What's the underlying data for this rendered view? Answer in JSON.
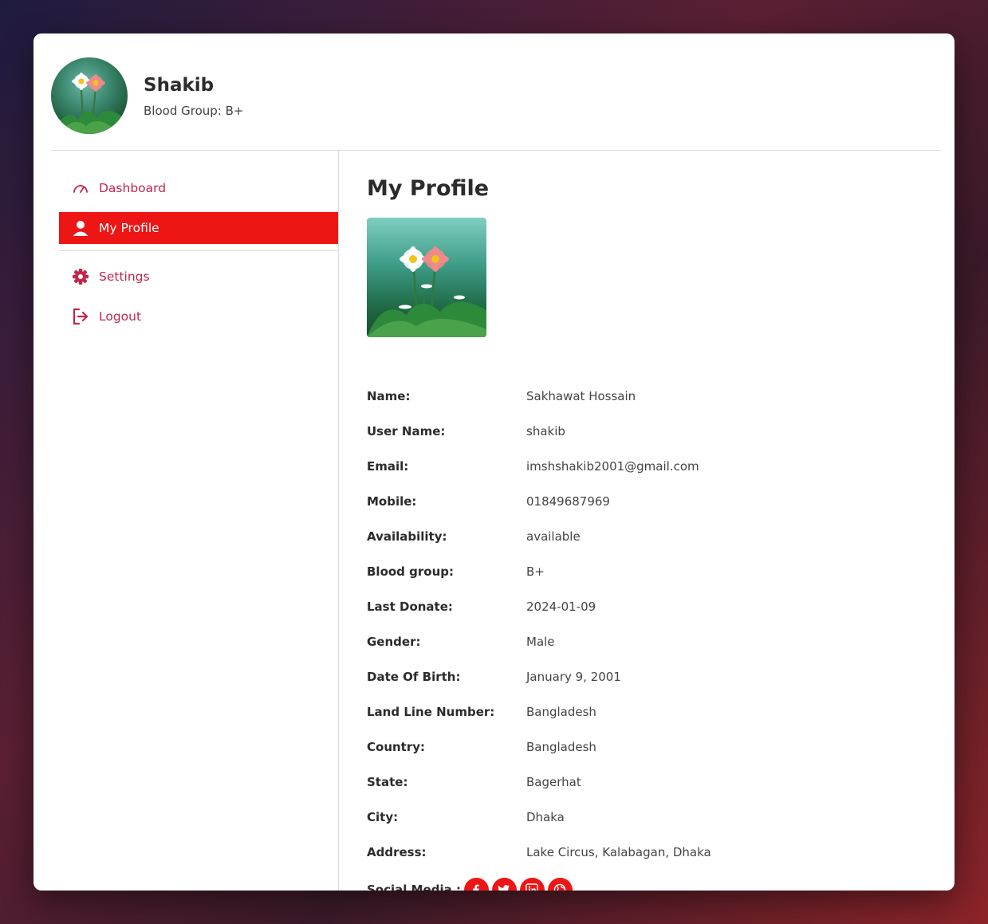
{
  "header": {
    "name": "Shakib",
    "blood_group": "Blood Group: B+"
  },
  "sidebar": {
    "items": [
      {
        "label": "Dashboard",
        "icon": "gauge-icon"
      },
      {
        "label": "My Profile",
        "icon": "user-icon",
        "active": true
      },
      {
        "label": "Settings",
        "icon": "gear-icon"
      },
      {
        "label": "Logout",
        "icon": "logout-icon"
      }
    ]
  },
  "main": {
    "title": "My Profile",
    "fields": [
      {
        "label": "Name:",
        "value": "Sakhawat Hossain"
      },
      {
        "label": "User Name:",
        "value": "shakib"
      },
      {
        "label": "Email:",
        "value": "imshshakib2001@gmail.com"
      },
      {
        "label": "Mobile:",
        "value": "01849687969"
      },
      {
        "label": "Availability:",
        "value": "available"
      },
      {
        "label": "Blood group:",
        "value": "B+"
      },
      {
        "label": "Last Donate:",
        "value": "2024-01-09"
      },
      {
        "label": "Gender:",
        "value": "Male"
      },
      {
        "label": "Date Of Birth:",
        "value": "January 9, 2001"
      },
      {
        "label": "Land Line Number:",
        "value": "Bangladesh"
      },
      {
        "label": "Country:",
        "value": "Bangladesh"
      },
      {
        "label": "State:",
        "value": "Bagerhat"
      },
      {
        "label": "City:",
        "value": "Dhaka"
      },
      {
        "label": "Address:",
        "value": "Lake Circus, Kalabagan, Dhaka"
      }
    ],
    "social_label": "Social Media :",
    "social_icons": [
      "facebook-icon",
      "twitter-icon",
      "linkedin-icon",
      "globe-icon"
    ]
  },
  "colors": {
    "accent": "#ee1515",
    "nav_text": "#c2274a"
  }
}
